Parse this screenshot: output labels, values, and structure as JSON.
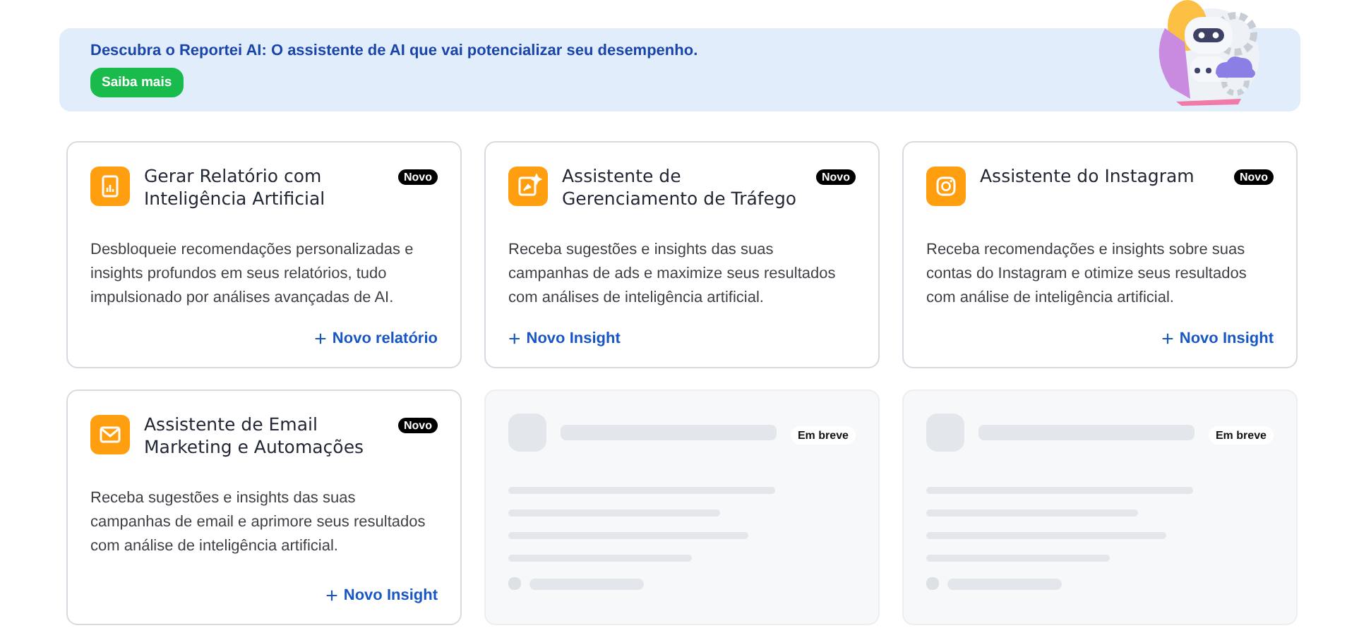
{
  "banner": {
    "text": "Descubra o Reportei AI: O assistente de AI que vai potencializar seu desempenho.",
    "button": "Saiba mais"
  },
  "cards": [
    {
      "kind": "feature",
      "title": "Gerar Relatório com Inteligência Artificial",
      "badge": "Novo",
      "description": "Desbloqueie recomendações personalizadas e insights profundos em seus relatórios, tudo impulsionado por análises avançadas de AI.",
      "action": {
        "icon": "+",
        "label": "Novo relatório",
        "kind": "end"
      }
    },
    {
      "kind": "feature",
      "title": "Assistente de Gerenciamento de Tráfego",
      "badge": "Novo",
      "description": "Receba sugestões e insights das suas campanhas de ads e maximize seus resultados com análises de inteligência artificial.",
      "action": {
        "icon": "+",
        "label": "Novo Insight",
        "kind": "start"
      }
    },
    {
      "kind": "feature",
      "title": "Assistente do Instagram",
      "badge": "Novo",
      "description": "Receba recomendações e insights sobre suas contas do Instagram e otimize seus resultados com análise de inteligência artificial.",
      "action": {
        "icon": "+",
        "label": "Novo Insight",
        "kind": "end"
      }
    },
    {
      "kind": "feature",
      "title": "Assistente de Email Marketing e Automações",
      "badge": "Novo",
      "description": "Receba sugestões e insights das suas campanhas de email e aprimore seus resultados com análise de inteligência artificial.",
      "action": {
        "icon": "+",
        "label": "Novo Insight",
        "kind": "end"
      }
    },
    {
      "kind": "placeholder",
      "badge": "Em breve"
    },
    {
      "kind": "placeholder",
      "badge": "Em breve"
    }
  ]
}
